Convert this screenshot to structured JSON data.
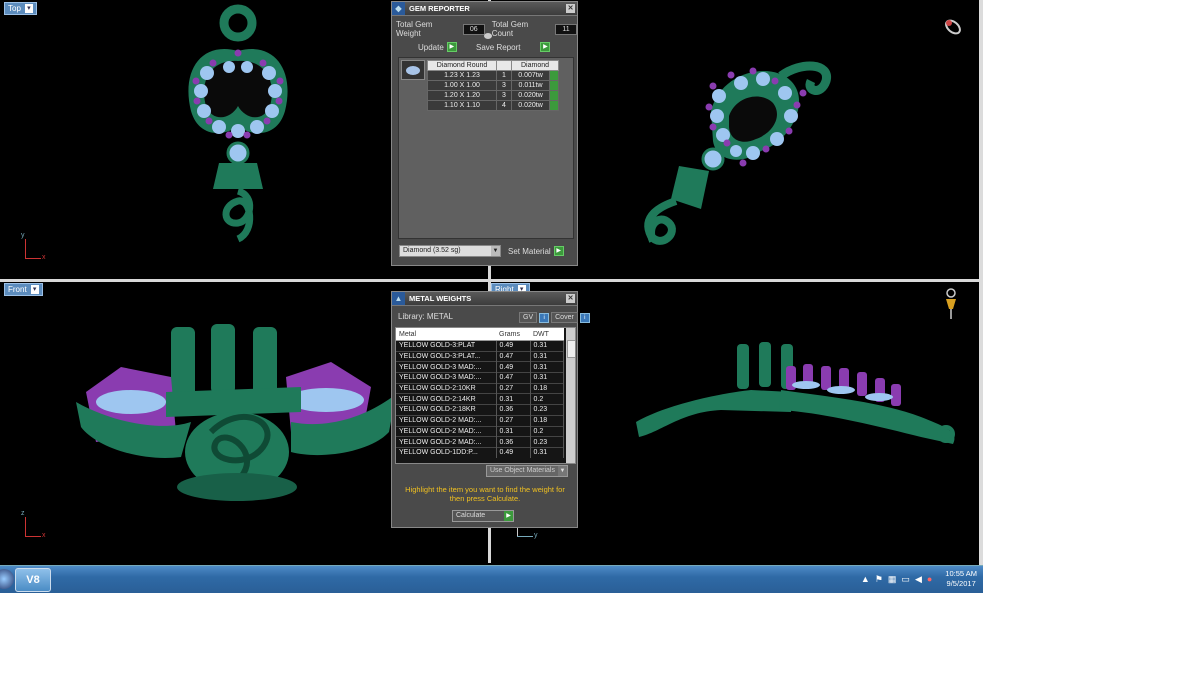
{
  "viewports": {
    "top_left": {
      "label": "Top",
      "axis_v": "y",
      "axis_h": "x"
    },
    "top_right": {
      "label": "",
      "axis_v": "",
      "axis_h": "x"
    },
    "bottom_left": {
      "label": "Front",
      "axis_v": "z",
      "axis_h": "x"
    },
    "bottom_right": {
      "label": "Right",
      "axis_v": "",
      "axis_h": "y"
    }
  },
  "gem_reporter": {
    "title": "GEM REPORTER",
    "total_weight_label": "Total Gem Weight",
    "total_weight_value": "06",
    "total_count_label": "Total Gem Count",
    "total_count_value": "11",
    "update_label": "Update",
    "save_report_label": "Save Report",
    "table_headers": [
      "Diamond Round",
      "",
      "Diamond"
    ],
    "rows": [
      {
        "size": "1.23 X 1.23",
        "count": "1",
        "weight": "0.007tw"
      },
      {
        "size": "1.00 X 1.00",
        "count": "3",
        "weight": "0.011tw"
      },
      {
        "size": "1.20 X 1.20",
        "count": "3",
        "weight": "0.020tw"
      },
      {
        "size": "1.10 X 1.10",
        "count": "4",
        "weight": "0.020tw"
      }
    ],
    "material_select": "Diamond    (3.52 sg)",
    "set_material_label": "Set Material"
  },
  "metal_weights": {
    "title": "METAL WEIGHTS",
    "library_label": "Library: METAL",
    "gv_label": "GV",
    "cover_label": "Cover",
    "headers": [
      "Metal",
      "Grams",
      "DWT"
    ],
    "rows": [
      {
        "metal": "YELLOW GOLD-3:PLAT",
        "grams": "0.49",
        "dwt": "0.31"
      },
      {
        "metal": "YELLOW GOLD-3:PLAT...",
        "grams": "0.47",
        "dwt": "0.31"
      },
      {
        "metal": "YELLOW GOLD-3 MAD:...",
        "grams": "0.49",
        "dwt": "0.31"
      },
      {
        "metal": "YELLOW GOLD-3 MAD:...",
        "grams": "0.47",
        "dwt": "0.31"
      },
      {
        "metal": "YELLOW GOLD-2:10KR",
        "grams": "0.27",
        "dwt": "0.18"
      },
      {
        "metal": "YELLOW GOLD-2:14KR",
        "grams": "0.31",
        "dwt": "0.2"
      },
      {
        "metal": "YELLOW GOLD-2:18KR",
        "grams": "0.36",
        "dwt": "0.23"
      },
      {
        "metal": "YELLOW GOLD-2 MAD:...",
        "grams": "0.27",
        "dwt": "0.18"
      },
      {
        "metal": "YELLOW GOLD-2 MAD:...",
        "grams": "0.31",
        "dwt": "0.2"
      },
      {
        "metal": "YELLOW GOLD-2 MAD:...",
        "grams": "0.36",
        "dwt": "0.23"
      },
      {
        "metal": "YELLOW GOLD-1DD:P...",
        "grams": "0.49",
        "dwt": "0.31"
      }
    ],
    "use_object_materials_label": "Use Object Materials",
    "hint_text": "Highlight the item you want to find the weight for then press Calculate.",
    "calculate_label": "Calculate"
  },
  "taskbar": {
    "app_label": "V8",
    "time": "10:55 AM",
    "date": "9/5/2017"
  },
  "colors": {
    "metal": "#1f7a5a",
    "gem": "#9ec6f0",
    "gem_accent": "#8a3cb0",
    "label_bg": "#5c8cbd"
  }
}
